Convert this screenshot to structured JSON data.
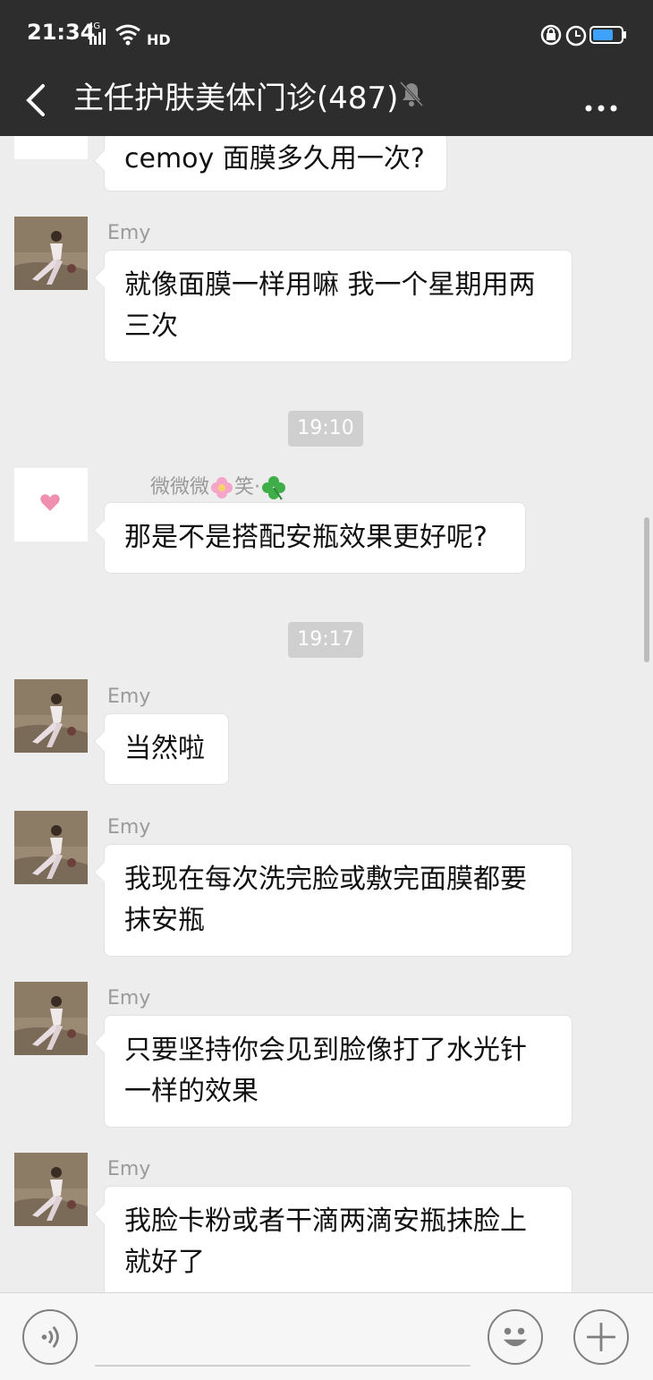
{
  "status": {
    "time": "21:34",
    "network": "4G",
    "hd": "HD"
  },
  "header": {
    "title": "主任护肤美体门诊(487)"
  },
  "messages": {
    "m0": "cemoy 面膜多久用一次?",
    "emy": "Emy",
    "m1": "就像面膜一样用嘛 我一个星期用两三次",
    "t1": "19:10",
    "wei": "微微微",
    "xiao": "笑",
    "m2": "那是不是搭配安瓶效果更好呢?",
    "t2": "19:17",
    "m3": "当然啦",
    "m4": "我现在每次洗完脸或敷完面膜都要抹安瓶",
    "m5": "只要坚持你会见到脸像打了水光针一样的效果",
    "m6": "我脸卡粉或者干滴两滴安瓶抹脸上就好了"
  },
  "colors": {
    "bar": "#2d2d2d",
    "bg": "#ededed",
    "bubble": "#ffffff",
    "battery": "#3fa2ff"
  },
  "icons": [
    "back-arrow-icon",
    "bell-mute-icon",
    "more-icon",
    "voice-icon",
    "emoji-icon",
    "plus-icon",
    "heart-icon",
    "flower-icon",
    "clover-icon"
  ]
}
